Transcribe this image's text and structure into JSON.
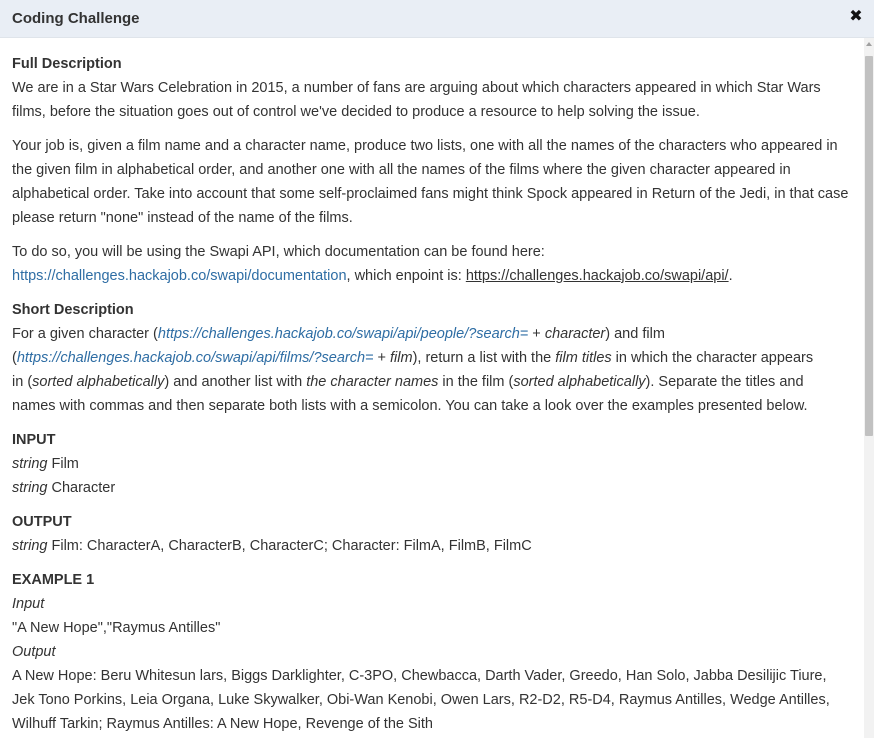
{
  "window": {
    "title": "Coding Challenge",
    "close_glyph": "✖",
    "close_icon": "close-icon"
  },
  "full_description": {
    "heading": "Full Description",
    "para1": "We are in a Star Wars Celebration in 2015, a number of fans are arguing about which characters appeared in which Star Wars films, before the situation goes out of control we've decided to produce a resource to help solving the issue.",
    "para2": "Your job is, given a film name and a character name, produce two lists, one with all the names of the characters who appeared in the given film in alphabetical order, and another one with all the names of the films where the given character appeared in alphabetical order. Take into account that some self-proclaimed fans might think Spock appeared in Return of the Jedi, in that case please return \"none\" instead of the name of the films.",
    "para3_text": "To do so, you will be using the Swapi API, which documentation can be found here:",
    "doc_link": "https://challenges.hackajob.co/swapi/documentation",
    "para3_mid": ", which enpoint is: ",
    "api_link": "https://challenges.hackajob.co/swapi/api/",
    "para3_end": "."
  },
  "short_description": {
    "heading": "Short Description",
    "t1": "For a given character (",
    "people_url": "https://challenges.hackajob.co/swapi/api/people/?search=",
    "t2": " + ",
    "character_word": "character",
    "t3": ") and film",
    "t4": "(",
    "films_url": "https://challenges.hackajob.co/swapi/api/films/?search=",
    "t5": " + ",
    "film_word": "film",
    "t6": "), return a list with the ",
    "film_titles": "film titles",
    "t7": " in which the character appears",
    "t8": "in (",
    "sorted1": "sorted alphabetically",
    "t9": ") and another list with ",
    "char_names": "the character names",
    "t10": " in the film (",
    "sorted2": "sorted alphabetically",
    "t11": "). Separate the titles and names with commas and then separate both lists with a semicolon. You can take a look over the examples presented below."
  },
  "input_section": {
    "heading": "INPUT",
    "lines": [
      {
        "type": "string",
        "name": " Film"
      },
      {
        "type": "string",
        "name": " Character"
      }
    ]
  },
  "output_section": {
    "heading": "OUTPUT",
    "type": "string",
    "text": " Film: CharacterA, CharacterB, CharacterC; Character: FilmA, FilmB, FilmC"
  },
  "example1": {
    "heading": "EXAMPLE 1",
    "input_label": "Input",
    "input_value": "\"A New Hope\",\"Raymus Antilles\"",
    "output_label": "Output",
    "output_value": "A New Hope: Beru Whitesun lars, Biggs Darklighter, C-3PO, Chewbacca, Darth Vader, Greedo, Han Solo, Jabba Desilijic Tiure, Jek Tono Porkins, Leia Organa, Luke Skywalker, Obi-Wan Kenobi, Owen Lars, R2-D2, R5-D4, Raymus Antilles, Wedge Antilles, Wilhuff Tarkin; Raymus Antilles: A New Hope, Revenge of the Sith"
  },
  "colors": {
    "titlebar_bg": "#e9eef5",
    "link": "#2e6da4",
    "text": "#333333"
  }
}
